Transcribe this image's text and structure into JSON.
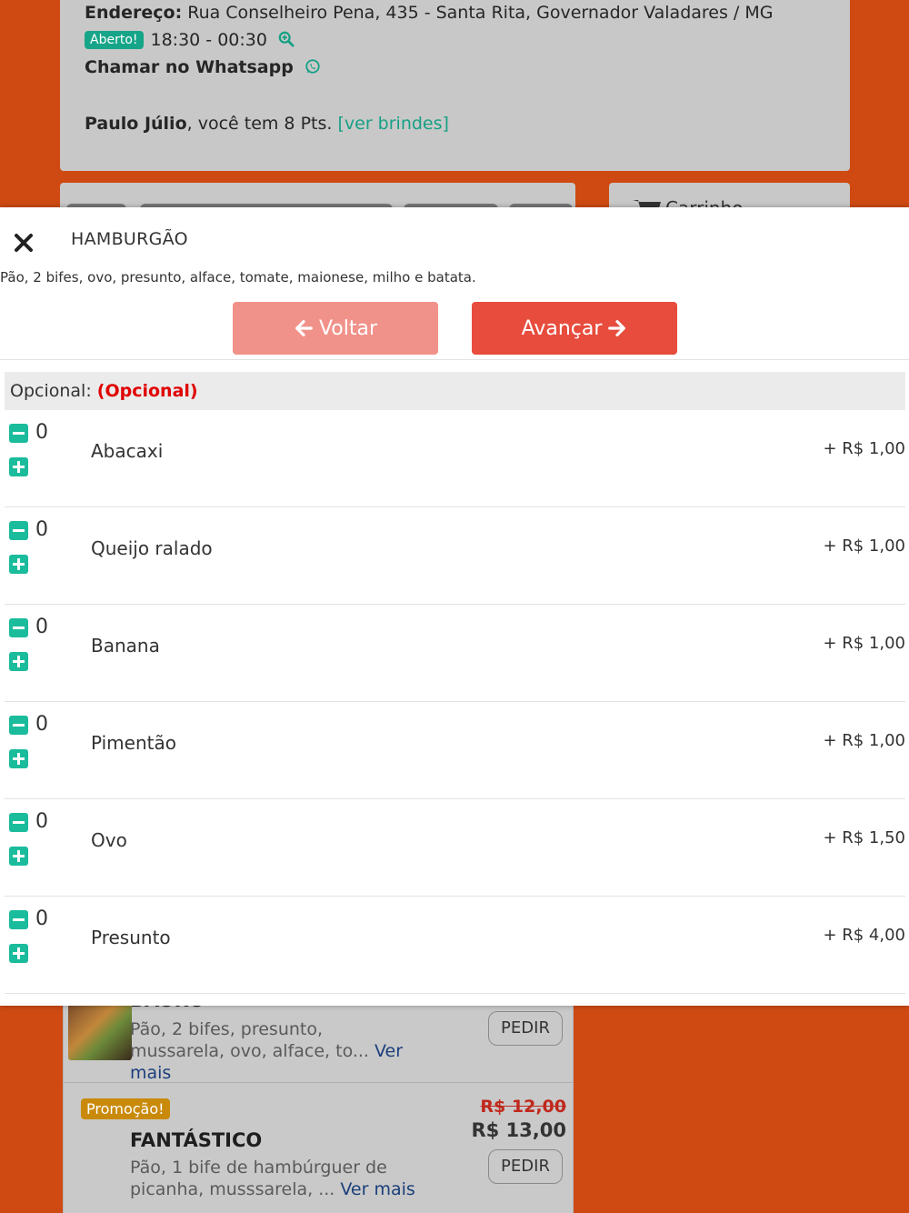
{
  "store": {
    "address_label": "Endereço:",
    "address": "Rua Conselheiro Pena, 435 - Santa Rita, Governador Valadares / MG",
    "status_badge": "Aberto!",
    "hours": "18:30 - 00:30",
    "whatsapp_label": "Chamar no Whatsapp",
    "user_name": "Paulo Júlio",
    "points_text": ", você tem 8 Pts.",
    "rewards_link": "[ver brindes]"
  },
  "cart": {
    "label": "Carrinho"
  },
  "modal": {
    "title": "HAMBURGÃO",
    "description": "Pão, 2 bifes, ovo, presunto, alface, tomate, maionese, milho e batata.",
    "back_label": "Voltar",
    "next_label": "Avançar",
    "section_label": "Opcional:",
    "section_flag": "(Opcional)",
    "options": [
      {
        "qty": "0",
        "name": "Abacaxi",
        "price": "+ R$ 1,00"
      },
      {
        "qty": "0",
        "name": "Queijo ralado",
        "price": "+ R$ 1,00"
      },
      {
        "qty": "0",
        "name": "Banana",
        "price": "+ R$ 1,00"
      },
      {
        "qty": "0",
        "name": "Pimentão",
        "price": "+ R$ 1,00"
      },
      {
        "qty": "0",
        "name": "Ovo",
        "price": "+ R$ 1,50"
      },
      {
        "qty": "0",
        "name": "Presunto",
        "price": "+ R$ 4,00"
      }
    ]
  },
  "menu": {
    "items": [
      {
        "name": "BAURU",
        "description": "Pão, 2 bifes, presunto, mussarela, ovo, alface, to...",
        "more": "Ver mais",
        "button": "PEDIR"
      },
      {
        "badge": "Promoção!",
        "name": "FANTÁSTICO",
        "old_price": "R$ 12,00",
        "price": "R$ 13,00",
        "description": "Pão, 1 bife de hambúrguer de picanha, musssarela, ...",
        "more": "Ver mais",
        "button": "PEDIR"
      }
    ]
  },
  "colors": {
    "background": "#cf4a12",
    "accent_teal": "#1abc9c",
    "next_button": "#e74c3c",
    "back_button": "#f1928a",
    "required_red": "#e00000"
  }
}
